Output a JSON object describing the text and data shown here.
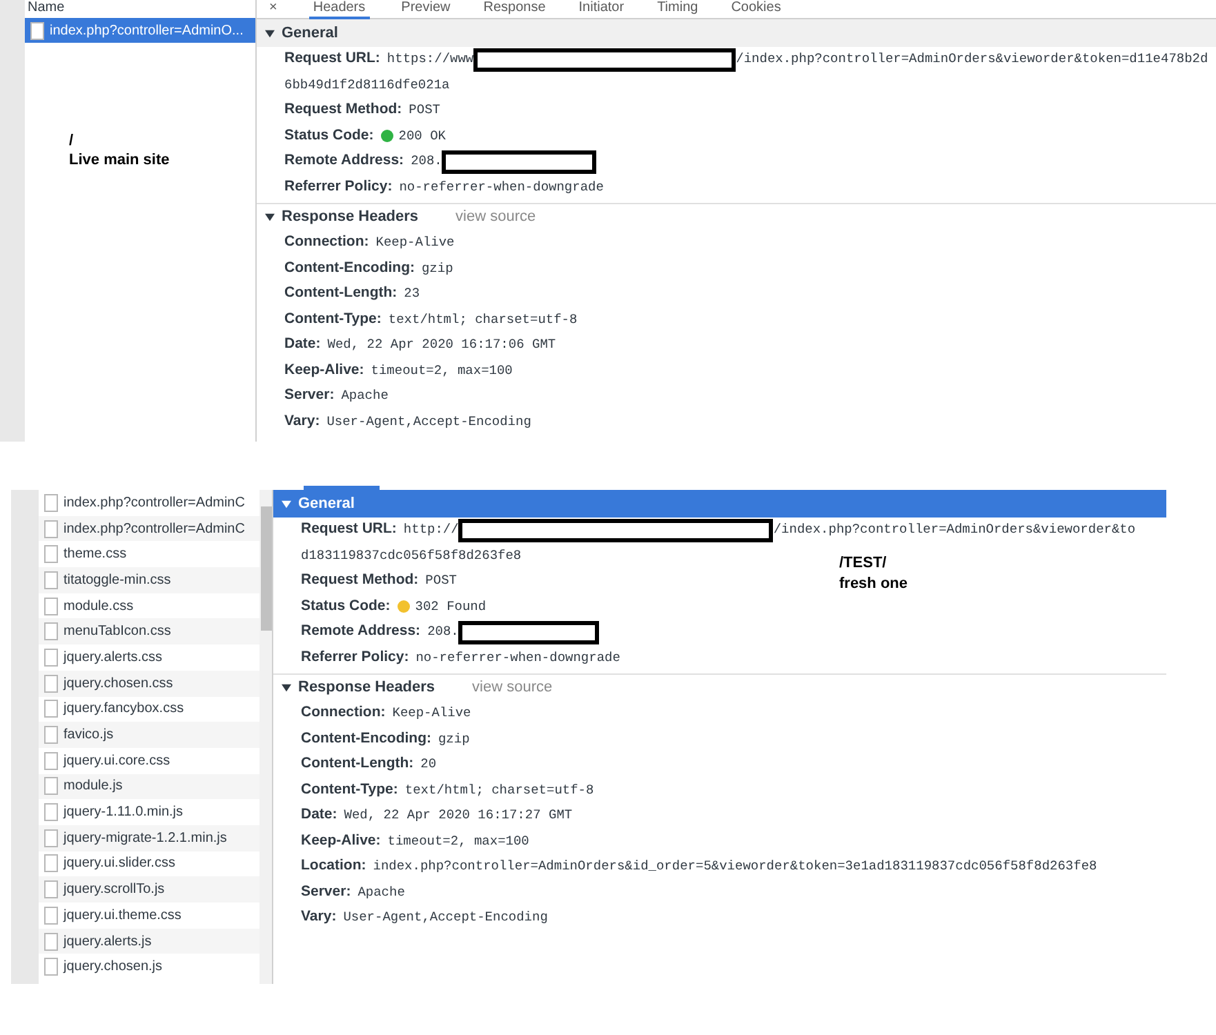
{
  "panels": [
    {
      "sidebar": {
        "heading": "Name",
        "files": [
          {
            "name": "index.php?controller=AdminO...",
            "selected": true
          }
        ]
      },
      "tabs": [
        {
          "label": "×",
          "selected": false
        },
        {
          "label": "Headers",
          "selected": true
        },
        {
          "label": "Preview",
          "selected": false
        },
        {
          "label": "Response",
          "selected": false
        },
        {
          "label": "Initiator",
          "selected": false
        },
        {
          "label": "Timing",
          "selected": false
        },
        {
          "label": "Cookies",
          "selected": false
        }
      ],
      "annotation": [
        "/",
        "Live main site"
      ],
      "sections": [
        {
          "title": "General",
          "selected": false,
          "expanded": true,
          "headers": [
            {
              "name": "Request URL:",
              "parts": [
                {
                  "kind": "text",
                  "text": "https://www"
                },
                {
                  "kind": "redacted"
                },
                {
                  "kind": "text",
                  "text": "/index.php?controller=AdminOrders&vieworder&token=d11e478b2d"
                }
              ],
              "continuation": "6bb49d1f2d8116dfe021a"
            },
            {
              "name": "Request Method:",
              "parts": [
                {
                  "kind": "text",
                  "text": "POST"
                }
              ]
            },
            {
              "name": "Status Code:",
              "parts": [
                {
                  "kind": "dot",
                  "color": "#2fb344"
                },
                {
                  "kind": "text",
                  "text": "200 OK"
                }
              ]
            },
            {
              "name": "Remote Address:",
              "parts": [
                {
                  "kind": "text",
                  "text": "208."
                },
                {
                  "kind": "redacted"
                }
              ]
            },
            {
              "name": "Referrer Policy:",
              "parts": [
                {
                  "kind": "text",
                  "text": "no-referrer-when-downgrade"
                }
              ]
            }
          ]
        },
        {
          "title": "Response Headers",
          "link": "view source",
          "selected": false,
          "expanded": true,
          "headers": [
            {
              "name": "Connection:",
              "parts": [
                {
                  "kind": "text",
                  "text": "Keep-Alive"
                }
              ]
            },
            {
              "name": "Content-Encoding:",
              "parts": [
                {
                  "kind": "text",
                  "text": "gzip"
                }
              ]
            },
            {
              "name": "Content-Length:",
              "parts": [
                {
                  "kind": "text",
                  "text": "23"
                }
              ]
            },
            {
              "name": "Content-Type:",
              "parts": [
                {
                  "kind": "text",
                  "text": "text/html; charset=utf-8"
                }
              ]
            },
            {
              "name": "Date:",
              "parts": [
                {
                  "kind": "text",
                  "text": "Wed, 22 Apr 2020 16:17:06 GMT"
                }
              ]
            },
            {
              "name": "Keep-Alive:",
              "parts": [
                {
                  "kind": "text",
                  "text": "timeout=2, max=100"
                }
              ]
            },
            {
              "name": "Server:",
              "parts": [
                {
                  "kind": "text",
                  "text": "Apache"
                }
              ]
            },
            {
              "name": "Vary:",
              "parts": [
                {
                  "kind": "text",
                  "text": "User-Agent,Accept-Encoding"
                }
              ]
            }
          ]
        }
      ]
    },
    {
      "sidebar": {
        "files": [
          {
            "name": "index.php?controller=AdminC",
            "selected": false
          },
          {
            "name": "index.php?controller=AdminC",
            "selected": false
          },
          {
            "name": "theme.css",
            "selected": false
          },
          {
            "name": "titatoggle-min.css",
            "selected": false
          },
          {
            "name": "module.css",
            "selected": false
          },
          {
            "name": "menuTabIcon.css",
            "selected": false
          },
          {
            "name": "jquery.alerts.css",
            "selected": false
          },
          {
            "name": "jquery.chosen.css",
            "selected": false
          },
          {
            "name": "jquery.fancybox.css",
            "selected": false
          },
          {
            "name": "favico.js",
            "selected": false
          },
          {
            "name": "jquery.ui.core.css",
            "selected": false
          },
          {
            "name": "module.js",
            "selected": false
          },
          {
            "name": "jquery-1.11.0.min.js",
            "selected": false
          },
          {
            "name": "jquery-migrate-1.2.1.min.js",
            "selected": false
          },
          {
            "name": "jquery.ui.slider.css",
            "selected": false
          },
          {
            "name": "jquery.scrollTo.js",
            "selected": false
          },
          {
            "name": "jquery.ui.theme.css",
            "selected": false
          },
          {
            "name": "jquery.alerts.js",
            "selected": false
          },
          {
            "name": "jquery.chosen.js",
            "selected": false
          }
        ]
      },
      "annotation": [
        "/TEST/",
        "fresh one"
      ],
      "sections": [
        {
          "title": "General",
          "selected": true,
          "expanded": true,
          "headers": [
            {
              "name": "Request URL:",
              "parts": [
                {
                  "kind": "text",
                  "text": "http://"
                },
                {
                  "kind": "redacted"
                },
                {
                  "kind": "text",
                  "text": "/index.php?controller=AdminOrders&vieworder&to"
                }
              ],
              "continuation": "d183119837cdc056f58f8d263fe8"
            },
            {
              "name": "Request Method:",
              "parts": [
                {
                  "kind": "text",
                  "text": "POST"
                }
              ]
            },
            {
              "name": "Status Code:",
              "parts": [
                {
                  "kind": "dot",
                  "color": "#f2c12e"
                },
                {
                  "kind": "text",
                  "text": "302 Found"
                }
              ]
            },
            {
              "name": "Remote Address:",
              "parts": [
                {
                  "kind": "text",
                  "text": "208."
                },
                {
                  "kind": "redacted"
                }
              ]
            },
            {
              "name": "Referrer Policy:",
              "parts": [
                {
                  "kind": "text",
                  "text": "no-referrer-when-downgrade"
                }
              ]
            }
          ]
        },
        {
          "title": "Response Headers",
          "link": "view source",
          "selected": false,
          "expanded": true,
          "headers": [
            {
              "name": "Connection:",
              "parts": [
                {
                  "kind": "text",
                  "text": "Keep-Alive"
                }
              ]
            },
            {
              "name": "Content-Encoding:",
              "parts": [
                {
                  "kind": "text",
                  "text": "gzip"
                }
              ]
            },
            {
              "name": "Content-Length:",
              "parts": [
                {
                  "kind": "text",
                  "text": "20"
                }
              ]
            },
            {
              "name": "Content-Type:",
              "parts": [
                {
                  "kind": "text",
                  "text": "text/html; charset=utf-8"
                }
              ]
            },
            {
              "name": "Date:",
              "parts": [
                {
                  "kind": "text",
                  "text": "Wed, 22 Apr 2020 16:17:27 GMT"
                }
              ]
            },
            {
              "name": "Keep-Alive:",
              "parts": [
                {
                  "kind": "text",
                  "text": "timeout=2, max=100"
                }
              ]
            },
            {
              "name": "Location:",
              "parts": [
                {
                  "kind": "text",
                  "text": "index.php?controller=AdminOrders&id_order=5&vieworder&token=3e1ad183119837cdc056f58f8d263fe8"
                }
              ]
            },
            {
              "name": "Server:",
              "parts": [
                {
                  "kind": "text",
                  "text": "Apache"
                }
              ]
            },
            {
              "name": "Vary:",
              "parts": [
                {
                  "kind": "text",
                  "text": "User-Agent,Accept-Encoding"
                }
              ]
            }
          ]
        }
      ]
    }
  ]
}
